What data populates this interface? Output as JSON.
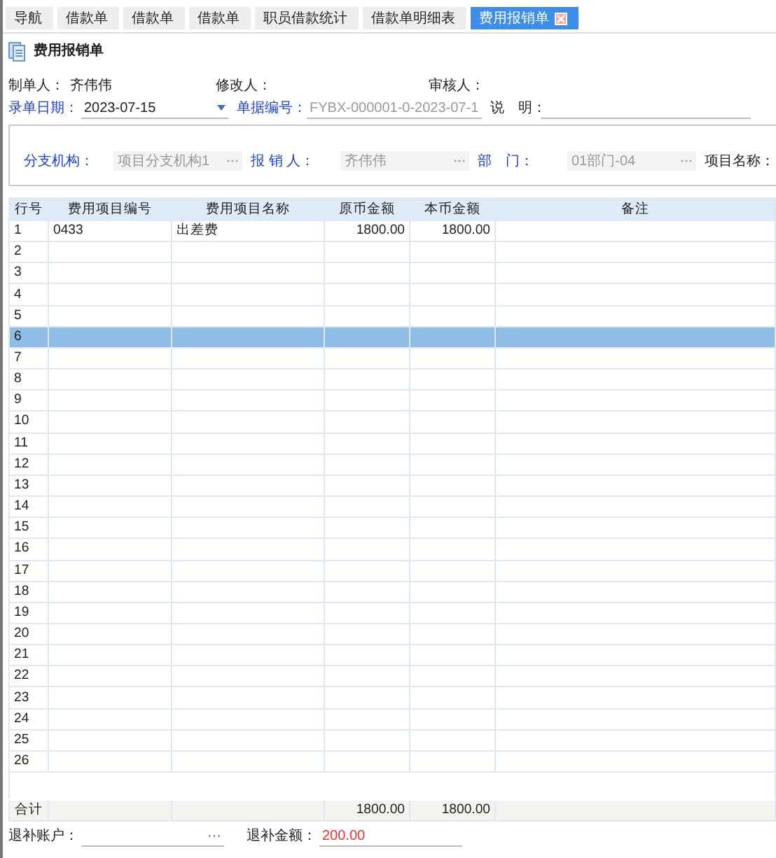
{
  "tabs": [
    {
      "label": "导航",
      "selected": false
    },
    {
      "label": "借款单",
      "selected": false
    },
    {
      "label": "借款单",
      "selected": false
    },
    {
      "label": "借款单",
      "selected": false
    },
    {
      "label": "职员借款统计",
      "selected": false
    },
    {
      "label": "借款单明细表",
      "selected": false
    },
    {
      "label": "费用报销单",
      "selected": true,
      "closable": true
    }
  ],
  "form_title": "费用报销单",
  "info": [
    {
      "label": "制单人：",
      "value": "齐伟伟"
    },
    {
      "label": "修改人："
    },
    {
      "label": "审核人："
    }
  ],
  "header_fields": [
    {
      "label": "录单日期：",
      "value": "2023-07-15",
      "kind": "dropdown"
    },
    {
      "label": "单据编号：",
      "value": "FYBX-000001-0-2023-07-1",
      "kind": "text",
      "disabled": true
    },
    {
      "label": "说　明：",
      "kind": "plain"
    }
  ],
  "group_fields": [
    {
      "label": "分支机构：",
      "value": "项目分支机构1",
      "disabled": true
    },
    {
      "label": "报 销 人：",
      "value": "齐伟伟",
      "disabled": true
    },
    {
      "label": "部　门：",
      "value": "01部门-04",
      "disabled": true
    },
    {
      "label": "项目名称："
    }
  ],
  "table": {
    "columns": [
      "行号",
      "费用项目编号",
      "费用项目名称",
      "原币金额",
      "本币金额",
      "备注"
    ],
    "rows": [
      {
        "cells": [
          "1",
          "0433",
          "出差费",
          "1800.00",
          "1800.00"
        ],
        "selected": false
      },
      {
        "cells": [
          "2"
        ],
        "selected": false
      },
      {
        "cells": [
          "3"
        ],
        "selected": false
      },
      {
        "cells": [
          "4"
        ],
        "selected": false
      },
      {
        "cells": [
          "5"
        ],
        "selected": false
      },
      {
        "cells": [
          "6"
        ],
        "selected": true
      },
      {
        "cells": [
          "7"
        ],
        "selected": false
      },
      {
        "cells": [
          "8"
        ],
        "selected": false
      },
      {
        "cells": [
          "9"
        ],
        "selected": false
      },
      {
        "cells": [
          "10"
        ],
        "selected": false
      },
      {
        "cells": [
          "11"
        ],
        "selected": false
      },
      {
        "cells": [
          "12"
        ],
        "selected": false
      },
      {
        "cells": [
          "13"
        ],
        "selected": false
      },
      {
        "cells": [
          "14"
        ],
        "selected": false
      },
      {
        "cells": [
          "15"
        ],
        "selected": false
      },
      {
        "cells": [
          "16"
        ],
        "selected": false
      },
      {
        "cells": [
          "17"
        ],
        "selected": false
      },
      {
        "cells": [
          "18"
        ],
        "selected": false
      },
      {
        "cells": [
          "19"
        ],
        "selected": false
      },
      {
        "cells": [
          "20"
        ],
        "selected": false
      },
      {
        "cells": [
          "21"
        ],
        "selected": false
      },
      {
        "cells": [
          "22"
        ],
        "selected": false
      },
      {
        "cells": [
          "23"
        ],
        "selected": false
      },
      {
        "cells": [
          "24"
        ],
        "selected": false
      },
      {
        "cells": [
          "25"
        ],
        "selected": false
      },
      {
        "cells": [
          "26"
        ],
        "selected": false
      }
    ],
    "totals": {
      "label": "合计",
      "original_amount": "1800.00",
      "local_amount": "1800.00"
    }
  },
  "footer": [
    {
      "label": "退补账户：",
      "kind": "lookup",
      "button": "···"
    },
    {
      "label": "退补金额：",
      "value": "200.00",
      "kind": "amount"
    }
  ]
}
